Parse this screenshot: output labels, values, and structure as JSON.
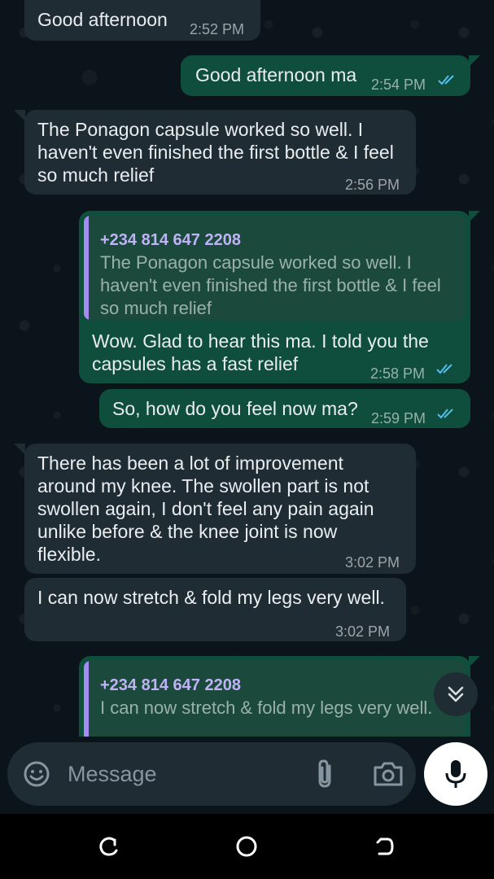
{
  "messages": [
    {
      "direction": "incoming",
      "text": "Good afternoon",
      "time": "2:52 PM"
    },
    {
      "direction": "outgoing",
      "text": "Good afternoon ma",
      "time": "2:54 PM",
      "status": "read"
    },
    {
      "direction": "incoming",
      "text": "The Ponagon capsule worked so well. I haven't even finished the first bottle & I feel so much relief",
      "time": "2:56 PM"
    },
    {
      "direction": "outgoing",
      "quote": {
        "sender": "+234 814 647 2208",
        "text": "The Ponagon capsule worked so well. I haven't even finished the first bottle & I feel so much relief"
      },
      "text": "Wow. Glad to hear this ma. I told you the capsules has a fast relief",
      "time": "2:58 PM",
      "status": "read"
    },
    {
      "direction": "outgoing",
      "text": "So, how do you feel now ma?",
      "time": "2:59 PM",
      "status": "read"
    },
    {
      "direction": "incoming",
      "text": "There has been a lot of improvement around my knee. The swollen part is not swollen again, I don't feel any pain again unlike before & the knee joint is now flexible.",
      "time": "3:02 PM"
    },
    {
      "direction": "incoming",
      "text": "I can now stretch & fold my legs very well.",
      "time": "3:02 PM"
    },
    {
      "direction": "outgoing",
      "quote": {
        "sender": "+234 814 647 2208",
        "text": "I can now stretch & fold my legs very well."
      },
      "text": "",
      "time": "",
      "status": ""
    }
  ],
  "composer": {
    "placeholder": "Message",
    "icons": [
      "emoji-icon",
      "attach-icon",
      "camera-icon",
      "mic-icon"
    ]
  },
  "scroll_button_icon": "double-chevron-down-icon",
  "navbar_icons": [
    "recent-apps-icon",
    "home-icon",
    "back-icon"
  ],
  "colors": {
    "background": "#0b141a",
    "incoming_bubble": "#202c33",
    "outgoing_bubble": "#0f4d3d",
    "read_ticks": "#53bdeb",
    "quote_sender": "#bfb2f7"
  }
}
